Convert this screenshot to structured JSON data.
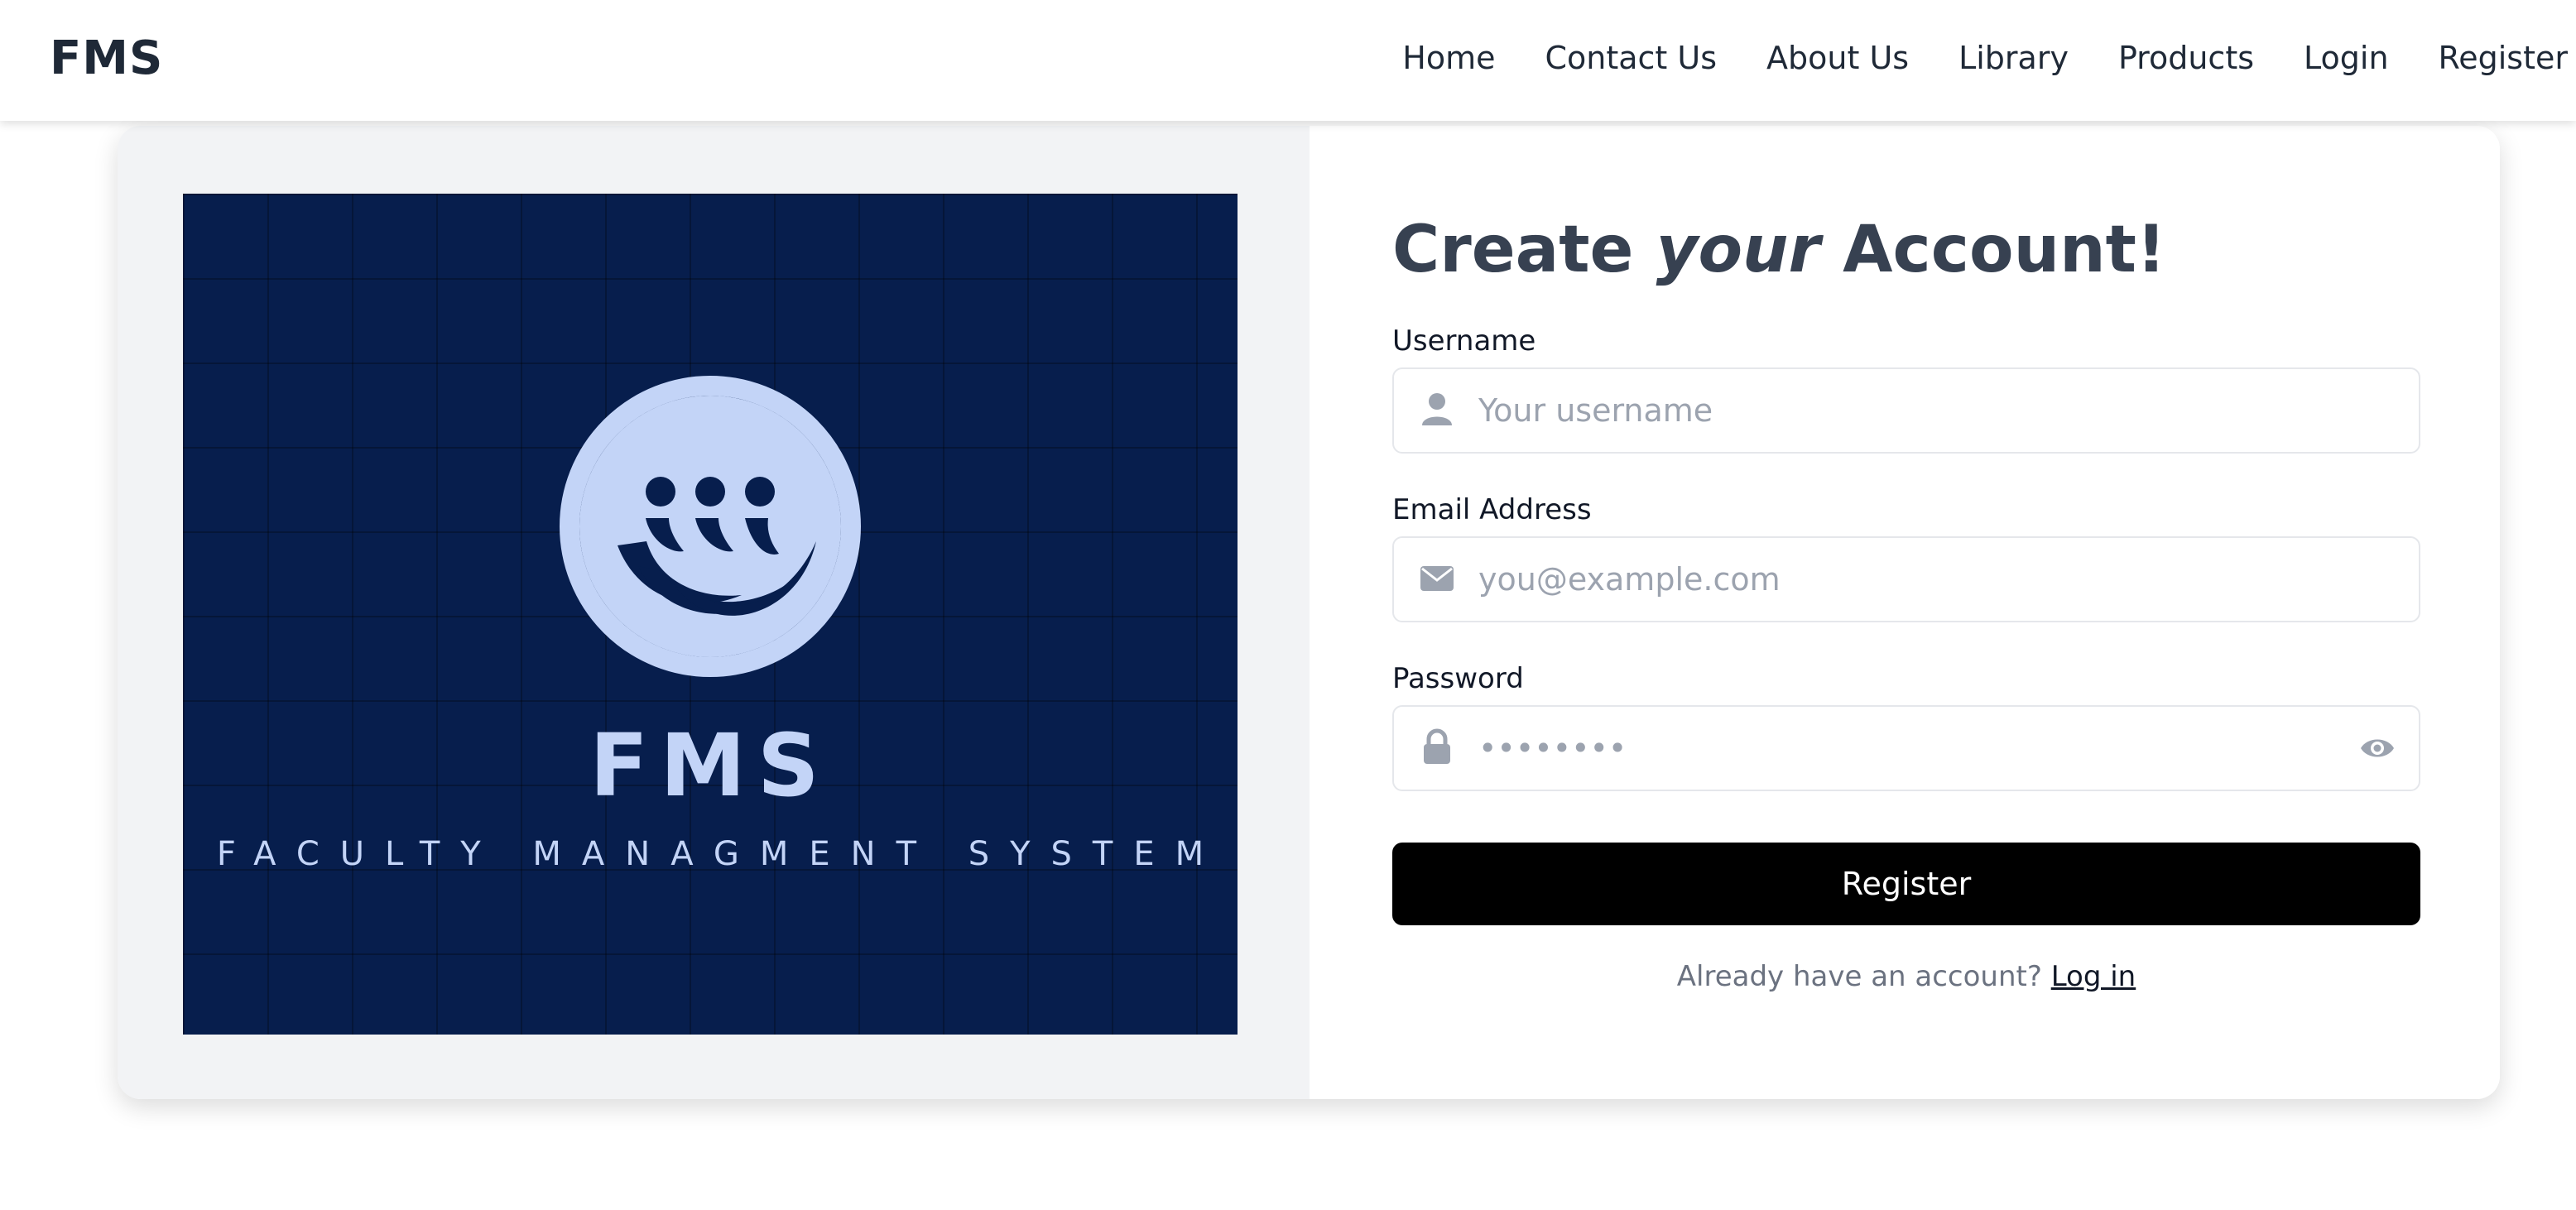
{
  "navbar": {
    "brand": "FMS",
    "links": [
      "Home",
      "Contact Us",
      "About Us",
      "Library",
      "Products",
      "Login",
      "Register"
    ]
  },
  "logo": {
    "title": "FMS",
    "subtitle": "FACULTY MANAGMENT SYSTEM",
    "icon": "people-wave-logo-icon",
    "background_color": "#071e4d",
    "accent_color": "#c3d4f7"
  },
  "form": {
    "title_prefix": "Create ",
    "title_emphasis": "your",
    "title_suffix": " Account!",
    "username": {
      "label": "Username",
      "placeholder": "Your username",
      "value": "",
      "icon": "user-icon"
    },
    "email": {
      "label": "Email Address",
      "placeholder": "you@example.com",
      "value": "",
      "icon": "envelope-icon"
    },
    "password": {
      "label": "Password",
      "placeholder": "••••••••",
      "value": "",
      "icon": "lock-icon",
      "toggle_icon": "eye-icon"
    },
    "submit_label": "Register",
    "login_prompt": "Already have an account?",
    "login_link": "Log in"
  },
  "colors": {
    "button_bg": "#000000",
    "heading": "#374151",
    "icon_gray": "#9ca3af"
  }
}
